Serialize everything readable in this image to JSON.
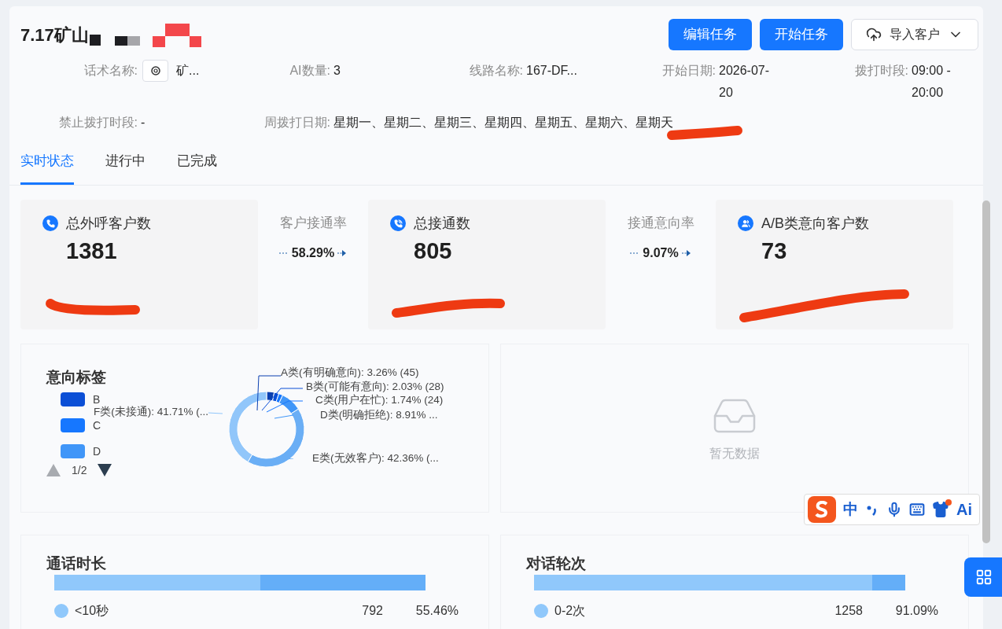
{
  "header": {
    "title": "7.17矿山",
    "buttons": [
      {
        "label": "编辑任务",
        "kind": "primary"
      },
      {
        "label": "开始任务",
        "kind": "primary"
      },
      {
        "label": "导入客户",
        "kind": "dropdown"
      }
    ]
  },
  "info": [
    {
      "label": "话术名称:",
      "value": "矿...",
      "kind": "script"
    },
    {
      "label": "AI数量:",
      "value": "3",
      "kind": "text"
    },
    {
      "label": "线路名称:",
      "value": "167-DF...",
      "kind": "text"
    },
    {
      "label": "开始日期:",
      "value": "2026-07-20",
      "kind": "text"
    },
    {
      "label": "拨打时段:",
      "value": "09:00 - 20:00",
      "kind": "text"
    },
    {
      "label": "禁止拨打时段:",
      "value": "-",
      "kind": "text"
    },
    {
      "label": "周拨打日期:",
      "value": "星期一、星期二、星期三、星期四、星期五、星期六、星期天",
      "kind": "wide"
    }
  ],
  "tabs": [
    {
      "label": "实时状态",
      "selected": true
    },
    {
      "label": "进行中",
      "selected": false
    },
    {
      "label": "已完成",
      "selected": false
    }
  ],
  "stats": [
    {
      "kind": "card",
      "label": "总外呼客户数",
      "value": "1381"
    },
    {
      "kind": "rate",
      "label": "客户接通率",
      "value": "58.29%"
    },
    {
      "kind": "card",
      "label": "总接通数",
      "value": "805"
    },
    {
      "kind": "rate",
      "label": "接通意向率",
      "value": "9.07%"
    },
    {
      "kind": "card",
      "label": "A/B类意向客户数",
      "value": "73"
    }
  ],
  "intent_panel": {
    "title": "意向标签",
    "legend": [
      {
        "label": "B",
        "color": "#0b4fd6"
      },
      {
        "label": "C",
        "color": "#1677ff"
      },
      {
        "label": "D",
        "color": "#4096f8"
      }
    ],
    "pager": "1/2",
    "chart_data": {
      "type": "donut",
      "categories": [
        "A类(有明确意向): 3.26% (45)",
        "B类(可能有意向): 2.03% (28)",
        "C类(用户在忙): 1.74% (24)",
        "D类(明确拒绝): 8.91% ...",
        "E类(无效客户): 42.36% (...",
        "F类(未接通): 41.71% (..."
      ],
      "values": [
        3.26,
        2.03,
        1.74,
        8.91,
        42.36,
        41.71
      ],
      "colors": [
        "#0a3fb0",
        "#0b4fd6",
        "#1677ff",
        "#4096f8",
        "#6aaef5",
        "#91c6fa"
      ]
    }
  },
  "empty_panel": {
    "message": "暂无数据"
  },
  "bar_panels": [
    {
      "title": "通话时长",
      "level": 0.5546,
      "rows": [
        {
          "label": "<10秒",
          "count": "792",
          "percent": "55.46%",
          "color": "#90c8fb"
        }
      ]
    },
    {
      "title": "对话轮次",
      "level": 0.9109,
      "rows": [
        {
          "label": "0-2次",
          "count": "1258",
          "percent": "91.09%",
          "color": "#90c8fb"
        }
      ]
    }
  ],
  "ime_toolbar": {
    "items": [
      "中",
      "Ai"
    ]
  }
}
